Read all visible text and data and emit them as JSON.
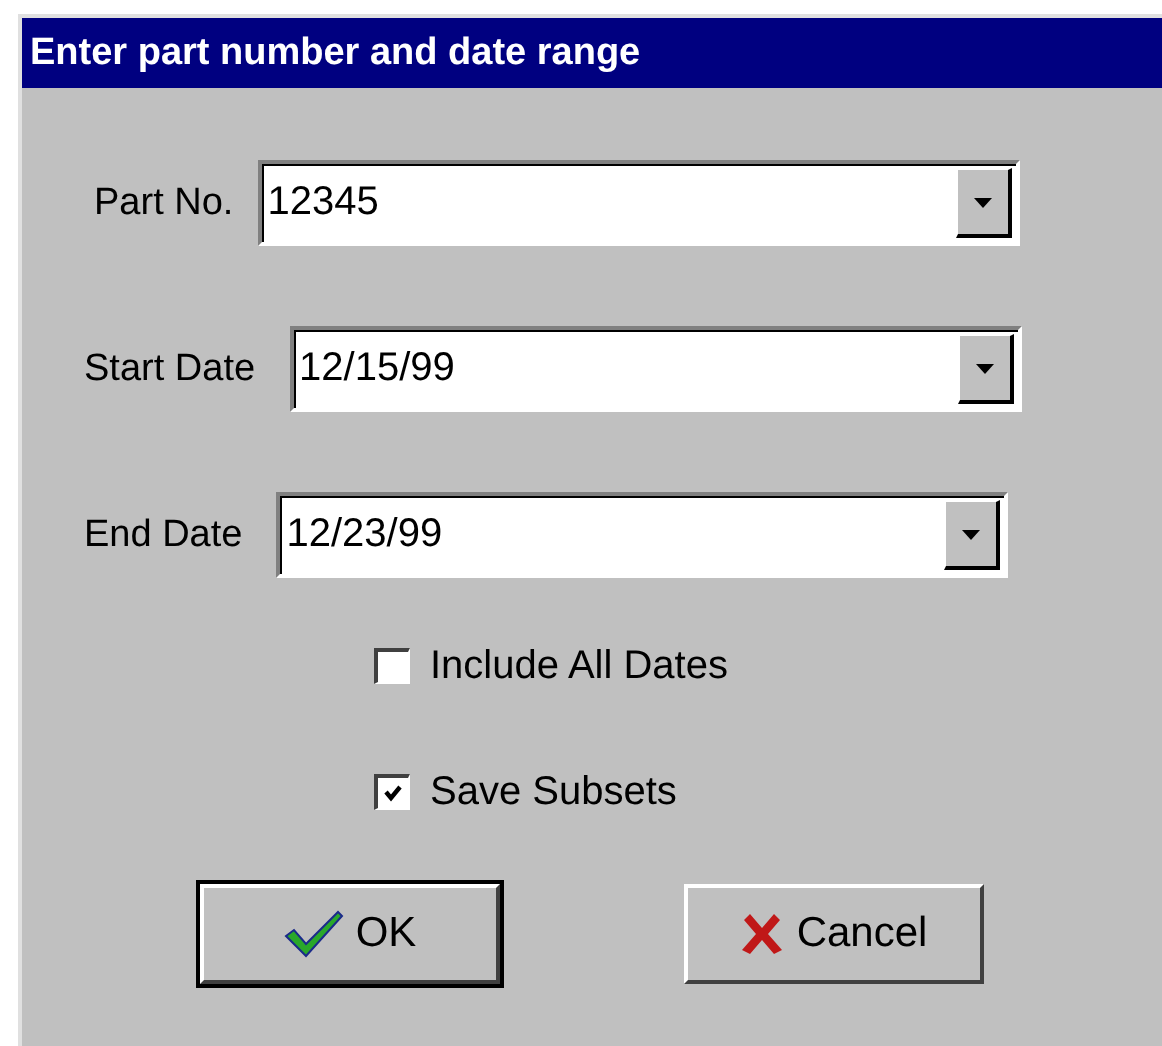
{
  "window": {
    "title": "Enter part number and date range"
  },
  "fields": [
    {
      "label": "Part No.",
      "value": "12345"
    },
    {
      "label": "Start Date",
      "value": "12/15/99"
    },
    {
      "label": "End Date",
      "value": "12/23/99"
    }
  ],
  "checkboxes": [
    {
      "label": "Include All Dates",
      "checked": false
    },
    {
      "label": "Save Subsets",
      "checked": true
    }
  ],
  "buttons": [
    {
      "label": "OK",
      "kind": "ok",
      "default": true
    },
    {
      "label": "Cancel",
      "kind": "cancel",
      "default": false
    }
  ]
}
